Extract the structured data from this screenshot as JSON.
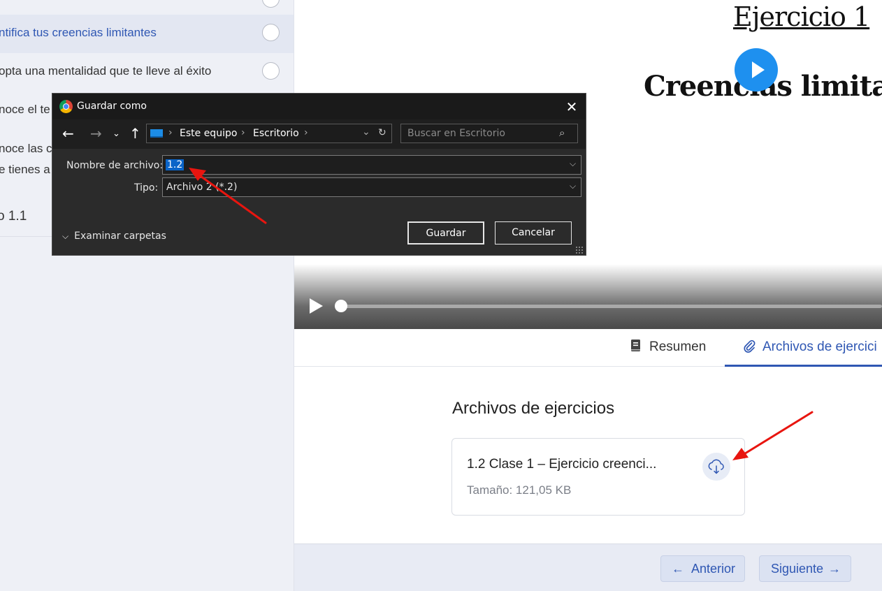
{
  "sidebar": {
    "lessons": [
      {
        "label": "ntifica tus creencias limitantes",
        "active": true
      },
      {
        "label": "opta una mentalidad que te lleve al éxito",
        "active": false
      },
      {
        "label": "noce el te",
        "active": false
      },
      {
        "label": "noce las c",
        "label2": "e tienes a",
        "active": false
      }
    ],
    "section_label": "o 1.1"
  },
  "video": {
    "title_line1": "Ejercicio 1",
    "title_line2": "Creencias limitad"
  },
  "tabs": [
    {
      "label": "Resumen",
      "icon": "book-icon",
      "active": false
    },
    {
      "label": "Archivos de ejercici",
      "icon": "paperclip-icon",
      "active": true
    }
  ],
  "files": {
    "heading": "Archivos de ejercicios",
    "items": [
      {
        "name": "1.2 Clase 1 – Ejercicio creenci...",
        "size": "Tamaño: 121,05 KB",
        "icon": "cloud-download-icon"
      }
    ]
  },
  "nav": {
    "prev_label": "Anterior",
    "next_label": "Siguiente"
  },
  "dialog": {
    "title": "Guardar como",
    "path": [
      "Este equipo",
      "Escritorio"
    ],
    "search_placeholder": "Buscar en Escritorio",
    "filename_label": "Nombre de archivo:",
    "filename_value": "1.2",
    "type_label": "Tipo:",
    "type_value": "Archivo 2 (*.2)",
    "browse_label": "Examinar carpetas",
    "save_label": "Guardar",
    "cancel_label": "Cancelar"
  },
  "colors": {
    "accent": "#2f57b3",
    "sidebar_bg": "#eef0f6",
    "dialog_bg": "#2b2b2b",
    "annotation": "#e8150f"
  }
}
